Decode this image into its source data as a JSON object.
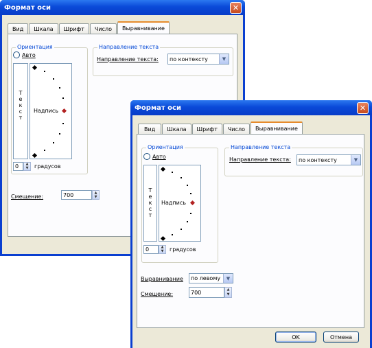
{
  "back": {
    "title": "Формат оси",
    "tabs": [
      "Вид",
      "Шкала",
      "Шрифт",
      "Число",
      "Выравнивание"
    ],
    "orientation_group": "Ориентация",
    "auto_label": "Авто",
    "vertical_text": [
      "Т",
      "е",
      "к",
      "с",
      "т"
    ],
    "rotated_text": "Надпись",
    "degrees_value": "0",
    "degrees_label": "градусов",
    "direction_group": "Направление текста",
    "direction_label": "Направление текста:",
    "direction_value": "по контексту",
    "offset_label": "Смещение:",
    "offset_value": "700"
  },
  "front": {
    "title": "Формат оси",
    "tabs": [
      "Вид",
      "Шкала",
      "Шрифт",
      "Число",
      "Выравнивание"
    ],
    "orientation_group": "Ориентация",
    "auto_label": "Авто",
    "vertical_text": [
      "Т",
      "е",
      "к",
      "с",
      "т"
    ],
    "rotated_text": "Надпись",
    "degrees_value": "0",
    "degrees_label": "градусов",
    "direction_group": "Направление текста",
    "direction_label": "Направление текста:",
    "direction_value": "по контексту",
    "alignment_label": "Выравнивание",
    "alignment_value": "по левому",
    "offset_label": "Смещение:",
    "offset_value": "700",
    "ok_label": "OK",
    "cancel_label": "Отмена"
  },
  "colors": {
    "titlebar": "#0a4ad8",
    "dialog_bg": "#ece9d8",
    "group_title": "#0046d5",
    "active_tab": "#e68b2c"
  }
}
